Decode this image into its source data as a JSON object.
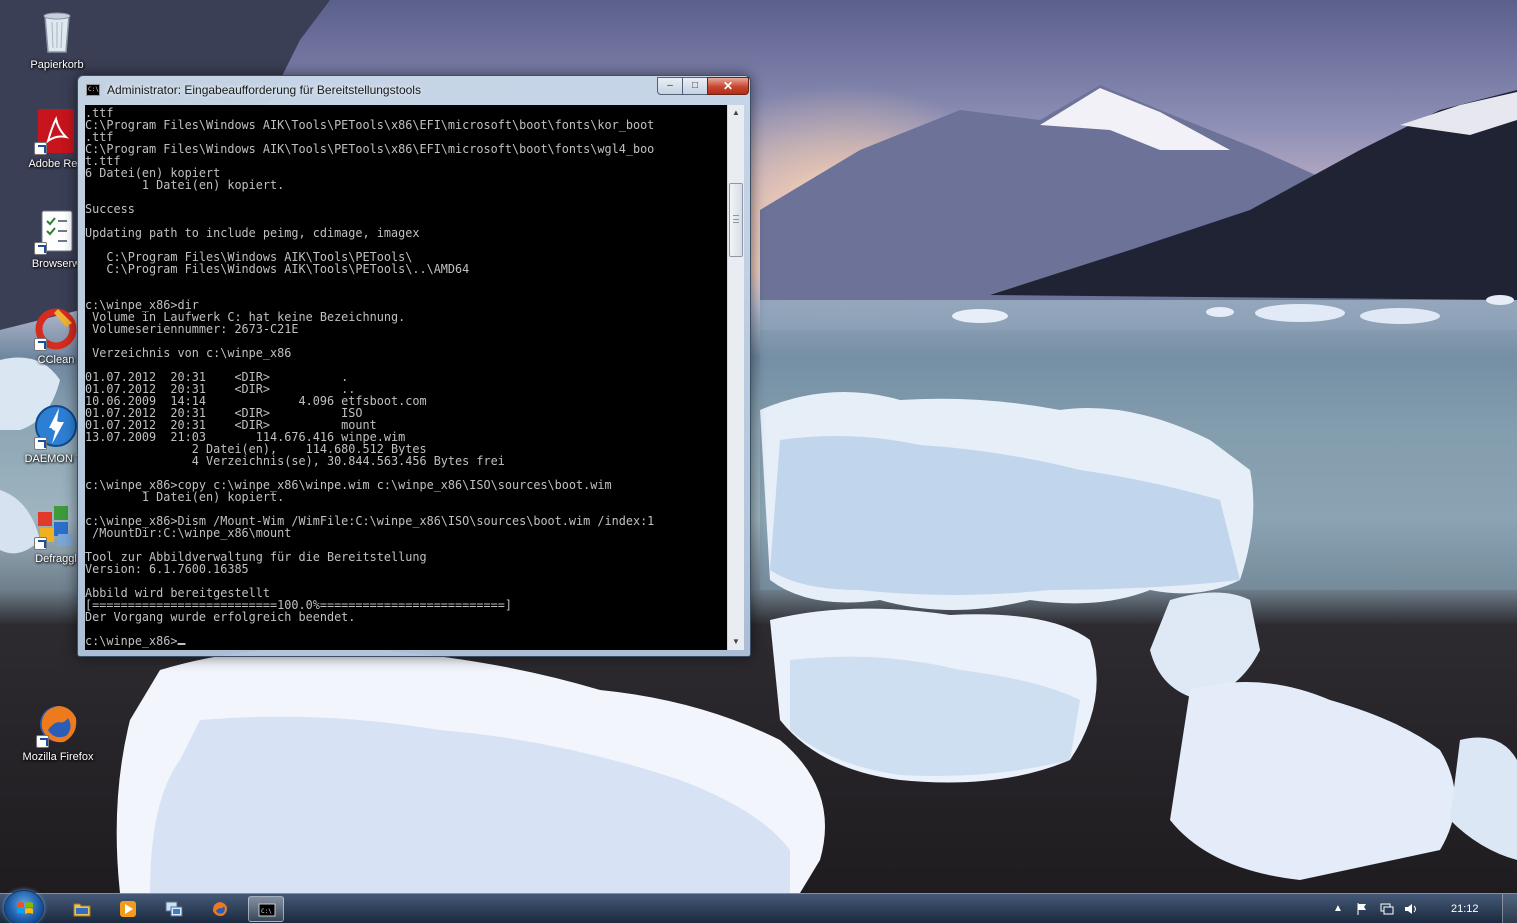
{
  "desktop": {
    "icons": [
      {
        "label": "Papierkorb",
        "icon": "recycle-bin-icon"
      },
      {
        "label": "Adobe Rea",
        "icon": "adobe-reader-icon"
      },
      {
        "label": "Browserw",
        "icon": "browser-choice-icon"
      },
      {
        "label": "CClean",
        "icon": "ccleaner-icon"
      },
      {
        "label": "DAEMON To",
        "icon": "daemon-tools-icon"
      },
      {
        "label": "Defraggl",
        "icon": "defraggler-icon"
      },
      {
        "label": "Mozilla Firefox",
        "icon": "firefox-icon"
      }
    ]
  },
  "window": {
    "title": "Administrator: Eingabeaufforderung für Bereitstellungstools",
    "minimize_label": "–",
    "maximize_label": "□",
    "close_label": "✕",
    "console_lines": [
      ".ttf",
      "C:\\Program Files\\Windows AIK\\Tools\\PETools\\x86\\EFI\\microsoft\\boot\\fonts\\kor_boot",
      ".ttf",
      "C:\\Program Files\\Windows AIK\\Tools\\PETools\\x86\\EFI\\microsoft\\boot\\fonts\\wgl4_boo",
      "t.ttf",
      "6 Datei(en) kopiert",
      "        1 Datei(en) kopiert.",
      "",
      "Success",
      "",
      "Updating path to include peimg, cdimage, imagex",
      "",
      "   C:\\Program Files\\Windows AIK\\Tools\\PETools\\",
      "   C:\\Program Files\\Windows AIK\\Tools\\PETools\\..\\AMD64",
      "",
      "",
      "c:\\winpe_x86>dir",
      " Volume in Laufwerk C: hat keine Bezeichnung.",
      " Volumeseriennummer: 2673-C21E",
      "",
      " Verzeichnis von c:\\winpe_x86",
      "",
      "01.07.2012  20:31    <DIR>          .",
      "01.07.2012  20:31    <DIR>          ..",
      "10.06.2009  14:14             4.096 etfsboot.com",
      "01.07.2012  20:31    <DIR>          ISO",
      "01.07.2012  20:31    <DIR>          mount",
      "13.07.2009  21:03       114.676.416 winpe.wim",
      "               2 Datei(en),    114.680.512 Bytes",
      "               4 Verzeichnis(se), 30.844.563.456 Bytes frei",
      "",
      "c:\\winpe_x86>copy c:\\winpe_x86\\winpe.wim c:\\winpe_x86\\ISO\\sources\\boot.wim",
      "        1 Datei(en) kopiert.",
      "",
      "c:\\winpe_x86>Dism /Mount-Wim /WimFile:C:\\winpe_x86\\ISO\\sources\\boot.wim /index:1",
      " /MountDir:C:\\winpe_x86\\mount",
      "",
      "Tool zur Abbildverwaltung für die Bereitstellung",
      "Version: 6.1.7600.16385",
      "",
      "Abbild wird bereitgestellt",
      "[==========================100.0%==========================]",
      "Der Vorgang wurde erfolgreich beendet.",
      ""
    ],
    "prompt": "c:\\winpe_x86>"
  },
  "taskbar": {
    "apps": [
      {
        "name": "explorer",
        "icon": "folder-icon",
        "active": false
      },
      {
        "name": "media-player",
        "icon": "media-player-icon",
        "active": false
      },
      {
        "name": "network",
        "icon": "network-icon",
        "active": false
      },
      {
        "name": "firefox",
        "icon": "firefox-icon",
        "active": false
      },
      {
        "name": "cmd",
        "icon": "cmd-icon",
        "active": true
      }
    ],
    "clock": "21:12"
  },
  "colors": {
    "console_bg": "#000000",
    "console_fg": "#c0c0c0",
    "close_button": "#c6462e"
  }
}
